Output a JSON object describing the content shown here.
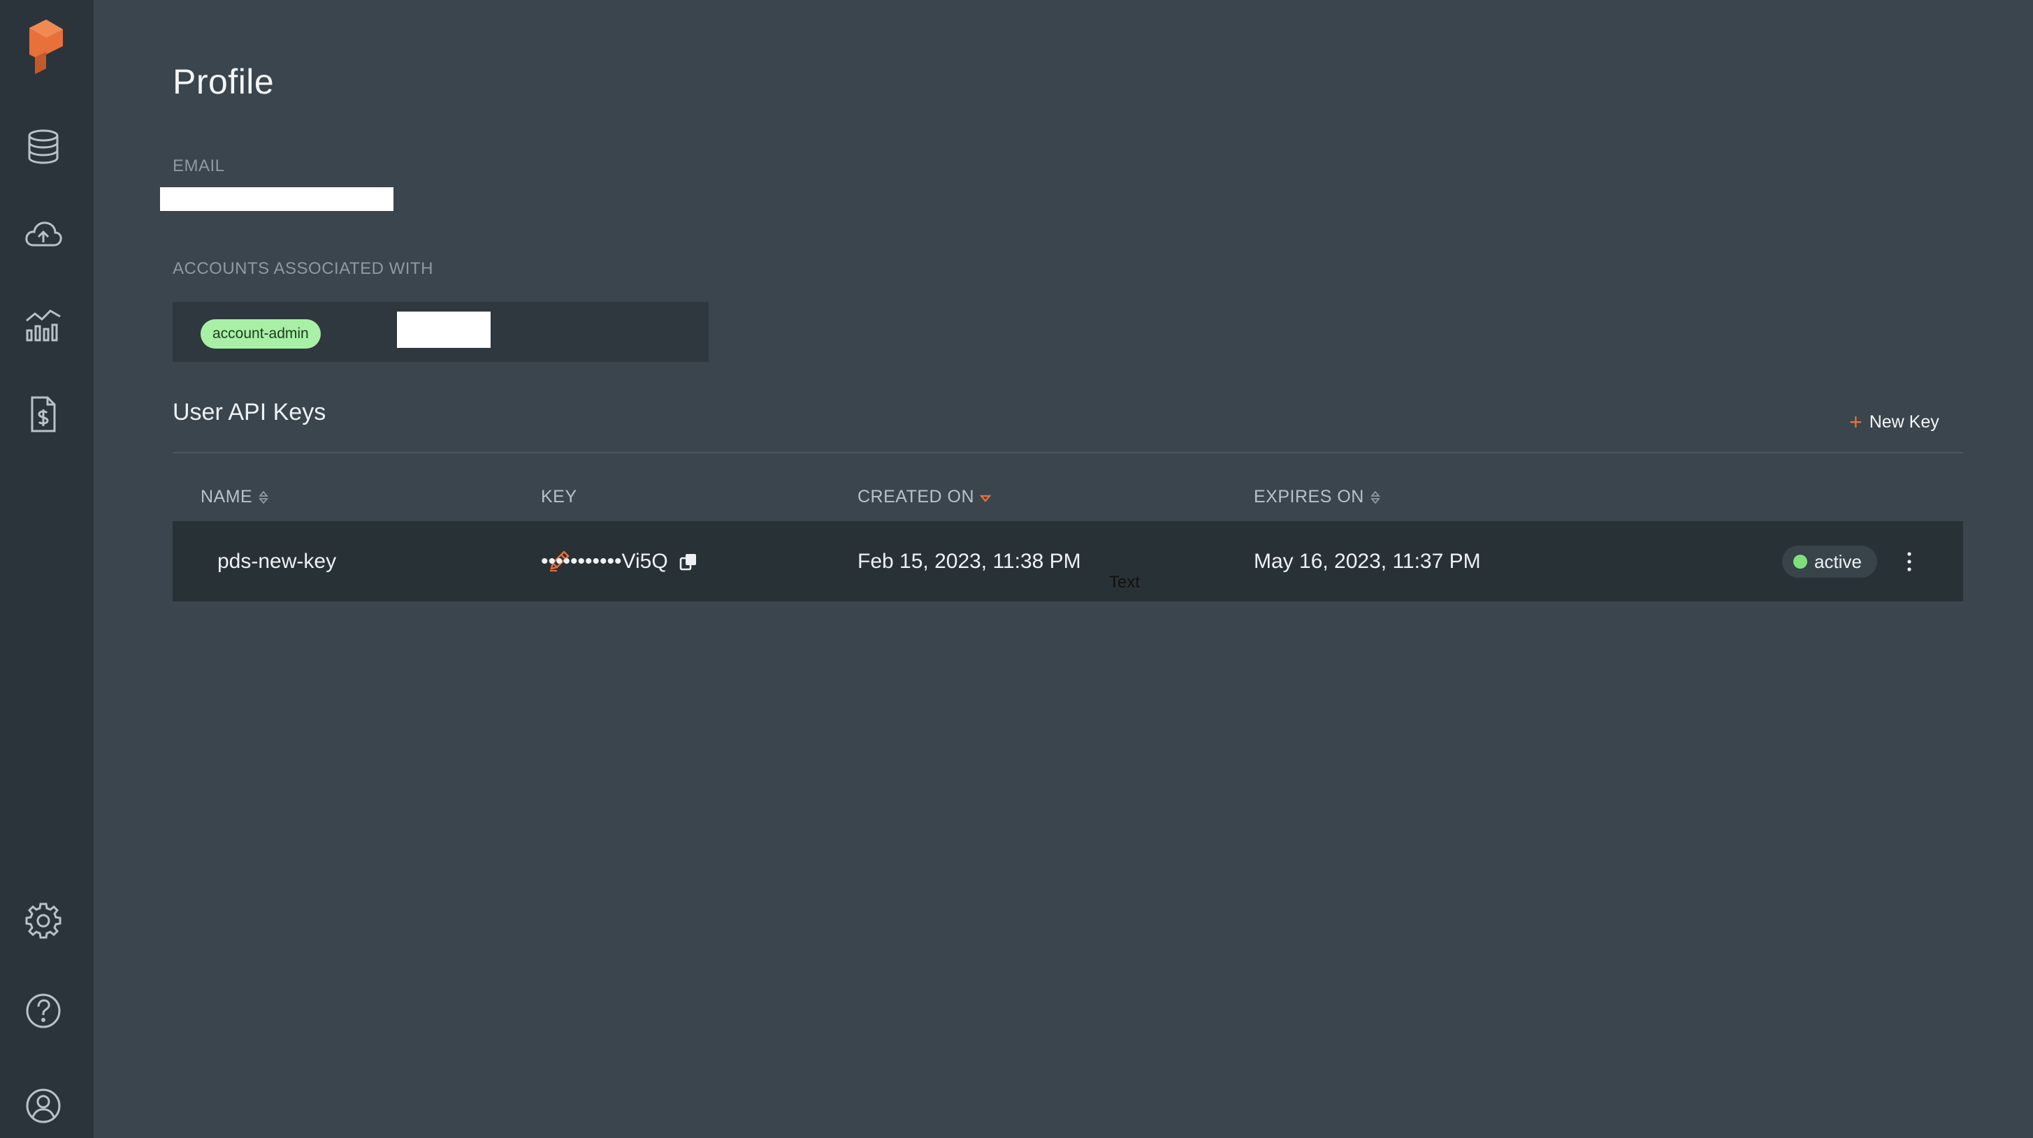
{
  "profile": {
    "title": "Profile",
    "email_label": "EMAIL",
    "accounts_label": "ACCOUNTS ASSOCIATED WITH",
    "accounts": [
      {
        "role": "account-admin"
      }
    ]
  },
  "sidebar": {
    "items": [
      {
        "icon": "database-icon"
      },
      {
        "icon": "cloud-upload-icon"
      },
      {
        "icon": "chart-icon"
      },
      {
        "icon": "billing-icon"
      },
      {
        "icon": "gear-icon"
      },
      {
        "icon": "help-icon"
      },
      {
        "icon": "user-icon"
      }
    ]
  },
  "api_keys": {
    "title": "User API Keys",
    "new_key_label": "New Key",
    "columns": {
      "name": "NAME",
      "key": "KEY",
      "created": "CREATED ON",
      "expires": "EXPIRES ON"
    },
    "rows": [
      {
        "name": "pds-new-key",
        "key": "•••••••••••Vi5Q",
        "created": "Feb 15, 2023, 11:38 PM",
        "expires": "May 16, 2023, 11:37 PM",
        "status": "active"
      }
    ]
  },
  "tooltip": "Text",
  "colors": {
    "accent": "#e8703a",
    "sidebar_bg": "#2b343a",
    "main_bg": "#3a454d",
    "active_green": "#7ee07b",
    "tag_green": "#a8f0a6"
  }
}
